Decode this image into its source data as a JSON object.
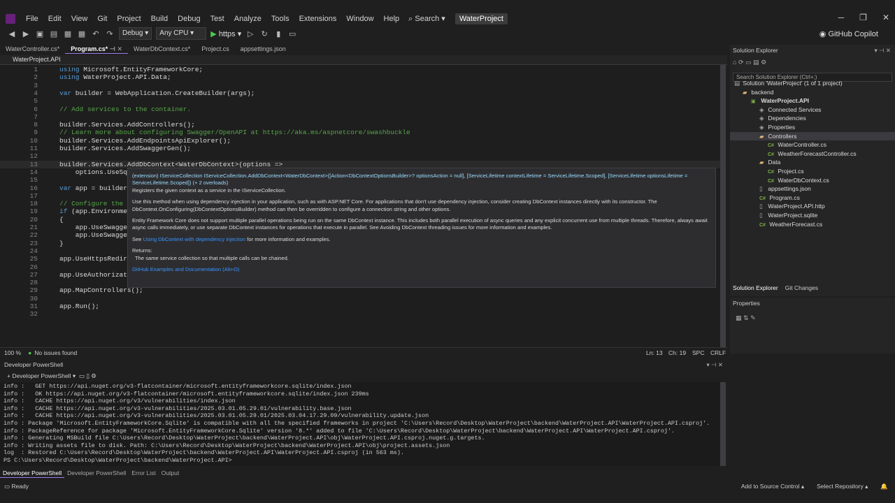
{
  "titlebar": {
    "menu": [
      "File",
      "Edit",
      "View",
      "Git",
      "Project",
      "Build",
      "Debug",
      "Test",
      "Analyze",
      "Tools",
      "Extensions",
      "Window",
      "Help"
    ],
    "search": "Search",
    "project": "WaterProject",
    "github_copilot": "GitHub Copilot"
  },
  "toolbar": {
    "config": "Debug",
    "platform": "Any CPU",
    "run": "https"
  },
  "tabs": [
    "WaterController.cs*",
    "Program.cs*",
    "WaterDbContext.cs*",
    "Project.cs",
    "appsettings.json"
  ],
  "navbar": {
    "project": "WaterProject.API"
  },
  "code": [
    {
      "n": "1",
      "t": "using Microsoft.EntityFrameworkCore;"
    },
    {
      "n": "2",
      "t": "using WaterProject.API.Data;"
    },
    {
      "n": "3",
      "t": ""
    },
    {
      "n": "4",
      "t": "var builder = WebApplication.CreateBuilder(args);"
    },
    {
      "n": "5",
      "t": ""
    },
    {
      "n": "6",
      "t": "// Add services to the container."
    },
    {
      "n": "7",
      "t": ""
    },
    {
      "n": "8",
      "t": "builder.Services.AddControllers();"
    },
    {
      "n": "9",
      "t": "// Learn more about configuring Swagger/OpenAPI at https://aka.ms/aspnetcore/swashbuckle"
    },
    {
      "n": "10",
      "t": "builder.Services.AddEndpointsApiExplorer();"
    },
    {
      "n": "11",
      "t": "builder.Services.AddSwaggerGen();"
    },
    {
      "n": "12",
      "t": ""
    },
    {
      "n": "13",
      "t": "builder.Services.AddDbContext<WaterDbContext>(options =>"
    },
    {
      "n": "14",
      "t": "    options.UseSqli"
    },
    {
      "n": "15",
      "t": ""
    },
    {
      "n": "16",
      "t": "var app = builder.B"
    },
    {
      "n": "17",
      "t": ""
    },
    {
      "n": "18",
      "t": "// Configure the HT"
    },
    {
      "n": "19",
      "t": "if (app.Environment"
    },
    {
      "n": "20",
      "t": "{"
    },
    {
      "n": "21",
      "t": "    app.UseSwagger("
    },
    {
      "n": "22",
      "t": "    app.UseSwaggerU"
    },
    {
      "n": "23",
      "t": "}"
    },
    {
      "n": "24",
      "t": ""
    },
    {
      "n": "25",
      "t": "app.UseHttpsRedirec"
    },
    {
      "n": "26",
      "t": ""
    },
    {
      "n": "27",
      "t": "app.UseAuthorizatio"
    },
    {
      "n": "28",
      "t": ""
    },
    {
      "n": "29",
      "t": "app.MapControllers();"
    },
    {
      "n": "30",
      "t": ""
    },
    {
      "n": "31",
      "t": "app.Run();"
    },
    {
      "n": "32",
      "t": ""
    }
  ],
  "tooltip": {
    "signature": "(extension) IServiceCollection IServiceCollection.AddDbContext<WaterDbContext>([Action<DbContextOptionsBuilder>? optionsAction = null], [ServiceLifetime contextLifetime = ServiceLifetime.Scoped], [ServiceLifetime optionsLifetime = ServiceLifetime.Scoped]) (+ 2 overloads)",
    "summary": "Registers the given context as a service in the IServiceCollection.",
    "para1": "Use this method when using dependency injection in your application, such as with ASP.NET Core. For applications that don't use dependency injection, consider creating DbContext instances directly with its constructor. The DbContext.OnConfiguring(DbContextOptionsBuilder) method can then be overridden to configure a connection string and other options.",
    "para2": "Entity Framework Core does not support multiple parallel operations being run on the same DbContext instance. This includes both parallel execution of async queries and any explicit concurrent use from multiple threads. Therefore, always await async calls immediately, or use separate DbContext instances for operations that execute in parallel. See Avoiding DbContext threading issues for more information and examples.",
    "see_prefix": "See ",
    "see_link": "Using DbContext with dependency injection",
    "see_suffix": " for more information and examples.",
    "returns_label": "Returns:",
    "returns_text": "The same service collection so that multiple calls can be chained.",
    "github_link": "GitHub Examples and Documentation (Alt+O)"
  },
  "editor_status": {
    "zoom": "100 %",
    "issues": "No issues found",
    "ln": "Ln: 13",
    "ch": "Ch: 19",
    "spc": "SPC",
    "crlf": "CRLF"
  },
  "solution_explorer": {
    "title": "Solution Explorer",
    "search_placeholder": "Search Solution Explorer (Ctrl+;)",
    "items": [
      {
        "label": "Solution 'WaterProject' (1 of 1 project)",
        "indent": 0,
        "kind": "solution"
      },
      {
        "label": "backend",
        "indent": 1,
        "kind": "folder"
      },
      {
        "label": "WaterProject.API",
        "indent": 2,
        "kind": "project"
      },
      {
        "label": "Connected Services",
        "indent": 3,
        "kind": "node"
      },
      {
        "label": "Dependencies",
        "indent": 3,
        "kind": "node"
      },
      {
        "label": "Properties",
        "indent": 3,
        "kind": "node"
      },
      {
        "label": "Controllers",
        "indent": 3,
        "kind": "folder"
      },
      {
        "label": "WaterController.cs",
        "indent": 4,
        "kind": "cs"
      },
      {
        "label": "WeatherForecastController.cs",
        "indent": 4,
        "kind": "cs"
      },
      {
        "label": "Data",
        "indent": 3,
        "kind": "folder"
      },
      {
        "label": "Project.cs",
        "indent": 4,
        "kind": "cs"
      },
      {
        "label": "WaterDbContext.cs",
        "indent": 4,
        "kind": "cs"
      },
      {
        "label": "appsettings.json",
        "indent": 3,
        "kind": "file"
      },
      {
        "label": "Program.cs",
        "indent": 3,
        "kind": "cs"
      },
      {
        "label": "WaterProject.API.http",
        "indent": 3,
        "kind": "file"
      },
      {
        "label": "WaterProject.sqlite",
        "indent": 3,
        "kind": "file"
      },
      {
        "label": "WeatherForecast.cs",
        "indent": 3,
        "kind": "cs"
      }
    ],
    "tabs": [
      "Solution Explorer",
      "Git Changes"
    ]
  },
  "properties": {
    "title": "Properties"
  },
  "terminal": {
    "title": "Developer PowerShell",
    "subtitle": "Developer PowerShell",
    "lines": [
      "info :   GET https://api.nuget.org/v3-flatcontainer/microsoft.entityframeworkcore.sqlite/index.json",
      "info :   OK https://api.nuget.org/v3-flatcontainer/microsoft.entityframeworkcore.sqlite/index.json 239ms",
      "info :   CACHE https://api.nuget.org/v3/vulnerabilities/index.json",
      "info :   CACHE https://api.nuget.org/v3-vulnerabilities/2025.03.01.05.29.01/vulnerability.base.json",
      "info :   CACHE https://api.nuget.org/v3-vulnerabilities/2025.03.01.05.29.01/2025.03.04.17.29.09/vulnerability.update.json",
      "info : Package 'Microsoft.EntityFrameworkCore.Sqlite' is compatible with all the specified frameworks in project 'C:\\Users\\Record\\Desktop\\WaterProject\\backend\\WaterProject.API\\WaterProject.API.csproj'.",
      "info : PackageReference for package 'Microsoft.EntityFrameworkCore.Sqlite' version '8.*' added to file 'C:\\Users\\Record\\Desktop\\WaterProject\\backend\\WaterProject.API\\WaterProject.API.csproj'.",
      "info : Generating MSBuild file C:\\Users\\Record\\Desktop\\WaterProject\\backend\\WaterProject.API\\obj\\WaterProject.API.csproj.nuget.g.targets.",
      "info : Writing assets file to disk. Path: C:\\Users\\Record\\Desktop\\WaterProject\\backend\\WaterProject.API\\obj\\project.assets.json",
      "log  : Restored C:\\Users\\Record\\Desktop\\WaterProject\\backend\\WaterProject.API\\WaterProject.API.csproj (in 563 ms).",
      "PS C:\\Users\\Record\\Desktop\\WaterProject\\backend\\WaterProject.API>"
    ]
  },
  "bottom_tabs": [
    "Developer PowerShell",
    "Developer PowerShell",
    "Error List",
    "Output"
  ],
  "statusbar": {
    "ready": "Ready",
    "source_control": "Add to Source Control",
    "repository": "Select Repository"
  }
}
